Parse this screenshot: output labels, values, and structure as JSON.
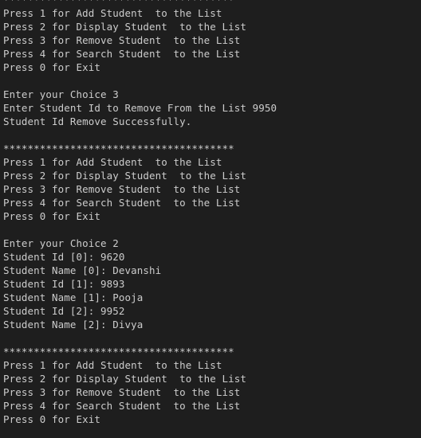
{
  "terminal": {
    "background": "#1e1e1e",
    "foreground": "#cccccc",
    "lines": [
      "**************************************",
      "Press 1 for Add Student  to the List",
      "Press 2 for Display Student  to the List",
      "Press 3 for Remove Student  to the List",
      "Press 4 for Search Student  to the List",
      "Press 0 for Exit",
      "",
      "Enter your Choice 3",
      "Enter Student Id to Remove From the List 9950",
      "Student Id Remove Successfully.",
      "",
      "**************************************",
      "Press 1 for Add Student  to the List",
      "Press 2 for Display Student  to the List",
      "Press 3 for Remove Student  to the List",
      "Press 4 for Search Student  to the List",
      "Press 0 for Exit",
      "",
      "Enter your Choice 2",
      "Student Id [0]: 9620",
      "Student Name [0]: Devanshi",
      "Student Id [1]: 9893",
      "Student Name [1]: Pooja",
      "Student Id [2]: 9952",
      "Student Name [2]: Divya",
      "",
      "**************************************",
      "Press 1 for Add Student  to the List",
      "Press 2 for Display Student  to the List",
      "Press 3 for Remove Student  to the List",
      "Press 4 for Search Student  to the List",
      "Press 0 for Exit"
    ]
  }
}
